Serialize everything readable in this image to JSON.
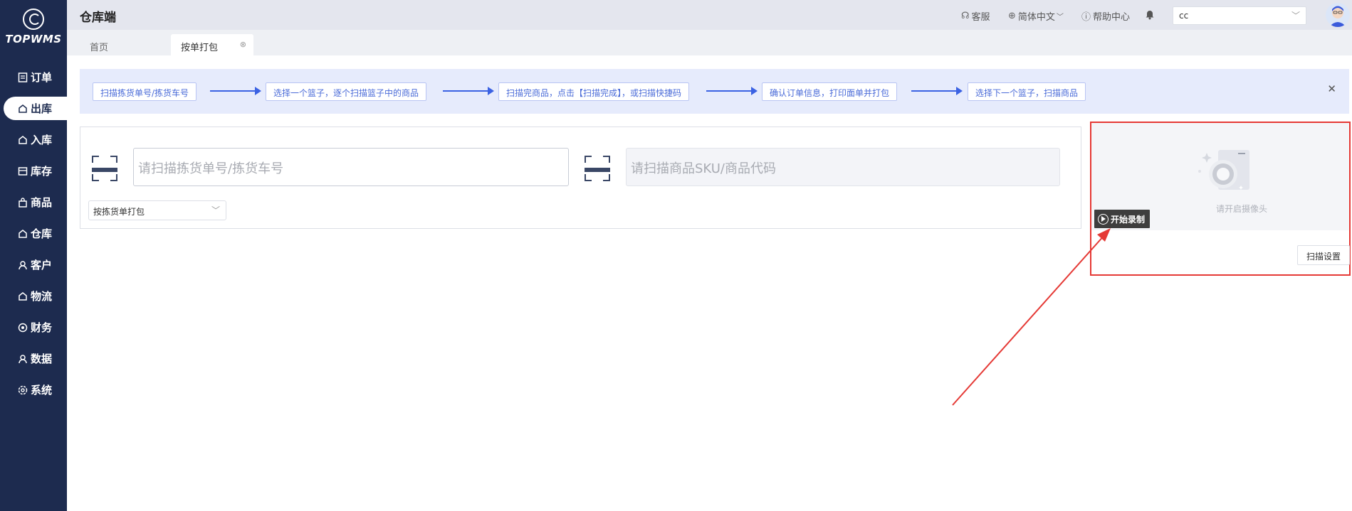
{
  "brand": {
    "name": "TOPWMS"
  },
  "sidebar": {
    "items": [
      {
        "label": "订单",
        "icon": "order-icon"
      },
      {
        "label": "出库",
        "icon": "outbound-icon",
        "active": true
      },
      {
        "label": "入库",
        "icon": "inbound-icon"
      },
      {
        "label": "库存",
        "icon": "inventory-icon"
      },
      {
        "label": "商品",
        "icon": "goods-icon"
      },
      {
        "label": "仓库",
        "icon": "warehouse-icon"
      },
      {
        "label": "客户",
        "icon": "customer-icon"
      },
      {
        "label": "物流",
        "icon": "logistics-icon"
      },
      {
        "label": "财务",
        "icon": "finance-icon"
      },
      {
        "label": "数据",
        "icon": "data-icon"
      },
      {
        "label": "系统",
        "icon": "system-icon"
      }
    ]
  },
  "header": {
    "title": "仓库端",
    "service_label": "客服",
    "language_label": "简体中文",
    "help_label": "帮助中心",
    "user_value": "cc"
  },
  "tabs": [
    {
      "label": "首页"
    },
    {
      "label": "按单打包",
      "active": true
    }
  ],
  "steps": [
    "扫描拣货单号/拣货车号",
    "选择一个篮子，逐个扫描篮子中的商品",
    "扫描完商品，点击【扫描完成】，或扫描快捷码",
    "确认订单信息，打印面单并打包",
    "选择下一个篮子，扫描商品"
  ],
  "scan": {
    "pick_placeholder": "请扫描拣货单号/拣货车号",
    "sku_placeholder": "请扫描商品SKU/商品代码",
    "mode_value": "按拣货单打包"
  },
  "camera": {
    "hint": "请开启摄像头",
    "record_label": "开始录制",
    "settings_label": "扫描设置"
  },
  "colors": {
    "sidebar_bg": "#1d2b4f",
    "accent": "#3b62e3",
    "highlight_box": "#e53935"
  }
}
